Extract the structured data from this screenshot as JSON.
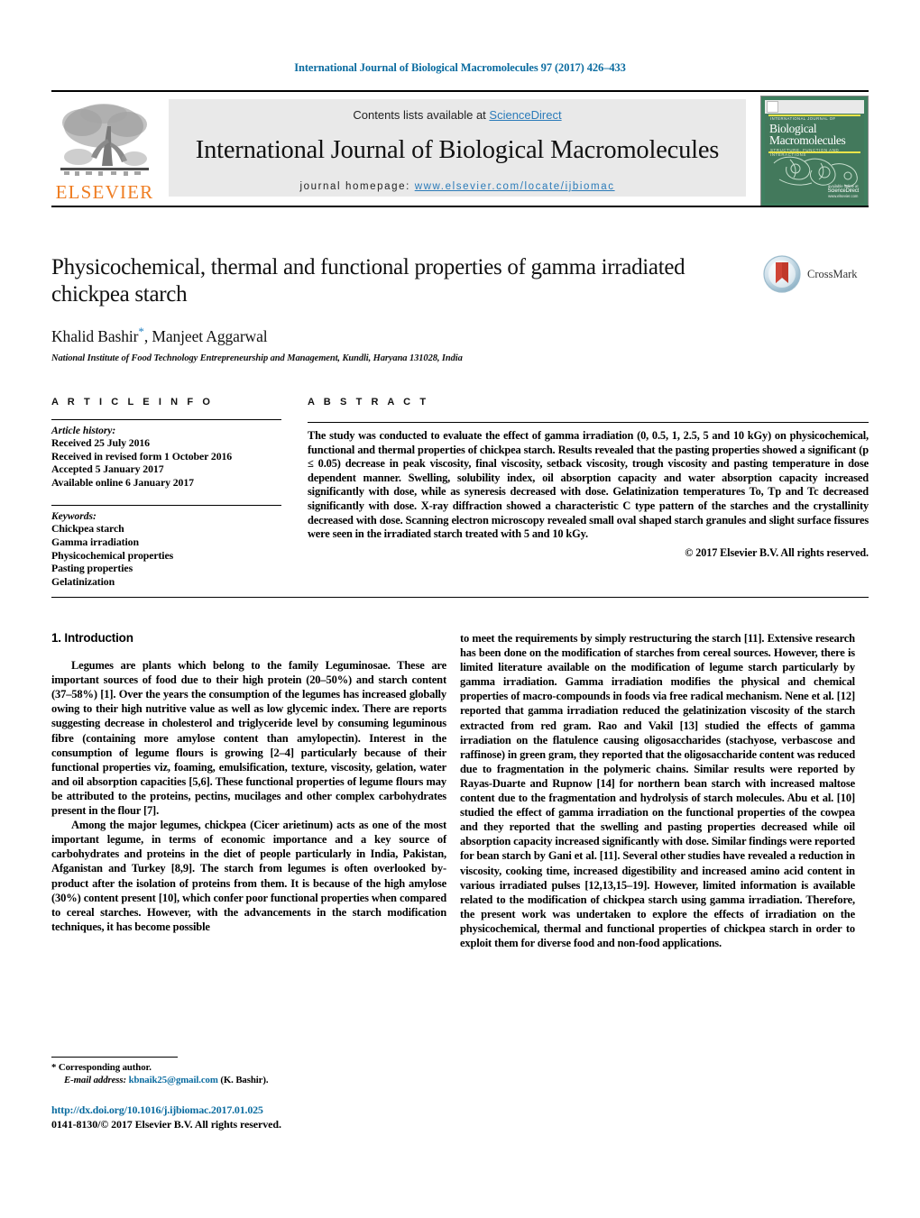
{
  "running_head": "International Journal of Biological Macromolecules 97 (2017) 426–433",
  "masthead": {
    "contents_prefix": "Contents lists available at ",
    "sciencedirect": "ScienceDirect",
    "journal_title": "International Journal of Biological Macromolecules",
    "homepage_prefix": "journal homepage: ",
    "homepage_url": "www.elsevier.com/locate/ijbiomac",
    "publisher": "ELSEVIER",
    "cover": {
      "small_title": "INTERNATIONAL JOURNAL OF",
      "line1": "Biological",
      "line2": "Macromolecules",
      "subtitle": "STRUCTURE, FUNCTION AND INTERACTIONS",
      "sd_label": "available online at",
      "sd_name": "ScienceDirect",
      "sd_url": "www.elsevier.com"
    }
  },
  "article": {
    "title": "Physicochemical, thermal and functional properties of gamma irradiated chickpea starch",
    "authors": "Khalid Bashir",
    "authors_rest": ", Manjeet Aggarwal",
    "corresponding_marker": "*",
    "affiliation": "National Institute of Food Technology Entrepreneurship and Management, Kundli, Haryana 131028, India",
    "crossmark_label": "CrossMark"
  },
  "info": {
    "heading": "A R T I C L E   I N F O",
    "history_heading": "Article history:",
    "history": [
      "Received 25 July 2016",
      "Received in revised form 1 October 2016",
      "Accepted 5 January 2017",
      "Available online 6 January 2017"
    ],
    "keywords_heading": "Keywords:",
    "keywords": [
      "Chickpea starch",
      "Gamma irradiation",
      "Physicochemical properties",
      "Pasting properties",
      "Gelatinization"
    ]
  },
  "abstract": {
    "heading": "A B S T R A C T",
    "text": "The study was conducted to evaluate the effect of gamma irradiation (0, 0.5, 1, 2.5, 5 and 10 kGy) on physicochemical, functional and thermal properties of chickpea starch. Results revealed that the pasting properties showed a significant (p ≤ 0.05) decrease in peak viscosity, final viscosity, setback viscosity, trough viscosity and pasting temperature in dose dependent manner. Swelling, solubility index, oil absorption capacity and water absorption capacity increased significantly with dose, while as syneresis decreased with dose. Gelatinization temperatures To, Tp and Tc decreased significantly with dose. X-ray diffraction showed a characteristic C type pattern of the starches and the crystallinity decreased with dose. Scanning electron microscopy revealed small oval shaped starch granules and slight surface fissures were seen in the irradiated starch treated with 5 and 10 kGy.",
    "copyright": "© 2017 Elsevier B.V. All rights reserved."
  },
  "body": {
    "section_number_title": "1.  Introduction",
    "left_paragraphs": [
      "Legumes are plants which belong to the family Leguminosae. These are important sources of food due to their high protein (20–50%) and starch content (37–58%) [1]. Over the years the consumption of the legumes has increased globally owing to their high nutritive value as well as low glycemic index. There are reports suggesting decrease in cholesterol and triglyceride level by consuming leguminous fibre (containing more amylose content than amylopectin). Interest in the consumption of legume flours is growing [2–4] particularly because of their functional properties viz, foaming, emulsification, texture, viscosity, gelation, water and oil absorption capacities [5,6]. These functional properties of legume flours may be attributed to the proteins, pectins, mucilages and other complex carbohydrates present in the flour [7].",
      "Among the major legumes, chickpea (Cicer arietinum) acts as one of the most important legume, in terms of economic importance and a key source of carbohydrates and proteins in the diet of people particularly in India, Pakistan, Afganistan and Turkey [8,9]. The starch from legumes is often overlooked by-product after the isolation of proteins from them. It is because of the high amylose (30%) content present [10], which confer poor functional properties when compared to cereal starches. However, with the advancements in the starch modification techniques, it has become possible"
    ],
    "right_paragraphs": [
      "to meet the requirements by simply restructuring the starch [11]. Extensive research has been done on the modification of starches from cereal sources. However, there is limited literature available on the modification of legume starch particularly by gamma irradiation. Gamma irradiation modifies the physical and chemical properties of macro-compounds in foods via free radical mechanism. Nene et al. [12] reported that gamma irradiation reduced the gelatinization viscosity of the starch extracted from red gram. Rao and Vakil [13] studied the effects of gamma irradiation on the flatulence causing oligosaccharides (stachyose, verbascose and raffinose) in green gram, they reported that the oligosaccharide content was reduced due to fragmentation in the polymeric chains. Similar results were reported by Rayas-Duarte and Rupnow [14] for northern bean starch with increased maltose content due to the fragmentation and hydrolysis of starch molecules. Abu et al. [10] studied the effect of gamma irradiation on the functional properties of the cowpea and they reported that the swelling and pasting properties decreased while oil absorption capacity increased significantly with dose. Similar findings were reported for bean starch by Gani et al. [11]. Several other studies have revealed a reduction in viscosity, cooking time, increased digestibility and increased amino acid content in various irradiated pulses [12,13,15–19]. However, limited information is available related to the modification of chickpea starch using gamma irradiation. Therefore, the present work was undertaken to explore the effects of irradiation on the physicochemical, thermal and functional properties of chickpea starch in order to exploit them for diverse food and non-food applications."
    ]
  },
  "footnote": {
    "corresponding": "*  Corresponding author.",
    "email_label": "E-mail address:",
    "email": "kbnaik25@gmail.com",
    "email_suffix": " (K. Bashir)."
  },
  "footer": {
    "doi": "http://dx.doi.org/10.1016/j.ijbiomac.2017.01.025",
    "issn_line": "0141-8130/© 2017 Elsevier B.V. All rights reserved."
  },
  "colors": {
    "link": "#0b6ca0",
    "accent_orange": "#ef7d22",
    "cover_green": "#43795c",
    "crossmark_red": "#c0392b"
  }
}
